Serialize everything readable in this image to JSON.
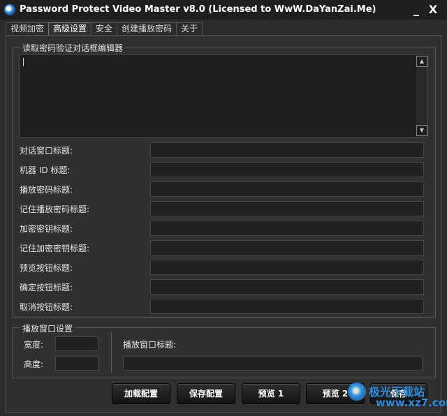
{
  "window": {
    "title": "Password Protect Video Master v8.0 (Licensed to WwW.DaYanZai.Me)",
    "min_label": "_",
    "close_label": "X"
  },
  "tabs": [
    {
      "label": "视频加密",
      "active": false
    },
    {
      "label": "高级设置",
      "active": true
    },
    {
      "label": "安全",
      "active": false
    },
    {
      "label": "创建播放密码",
      "active": false
    },
    {
      "label": "关于",
      "active": false
    }
  ],
  "editor_group": {
    "label": "读取密码验证对话框编辑器",
    "content": ""
  },
  "fields": [
    {
      "label": "对话窗口标题:",
      "value": ""
    },
    {
      "label": "机器 ID 标题:",
      "value": ""
    },
    {
      "label": "播放密码标题:",
      "value": ""
    },
    {
      "label": "记住播放密码标题:",
      "value": ""
    },
    {
      "label": "加密密钥标题:",
      "value": ""
    },
    {
      "label": "记住加密密钥标题:",
      "value": ""
    },
    {
      "label": "预览按钮标题:",
      "value": ""
    },
    {
      "label": "确定按钮标题:",
      "value": ""
    },
    {
      "label": "取消按钮标题:",
      "value": ""
    }
  ],
  "player_group": {
    "label": "播放窗口设置",
    "width_label": "宽度:",
    "width_value": "",
    "height_label": "高度:",
    "height_value": "",
    "title_label": "播放窗口标题:",
    "title_value": ""
  },
  "buttons": {
    "load": "加载配置",
    "save_config": "保存配置",
    "preview1": "预览 1",
    "preview2": "预览 2",
    "save": "保存"
  },
  "watermark": {
    "text": "极光下载站",
    "url": "www.xz7.com"
  }
}
